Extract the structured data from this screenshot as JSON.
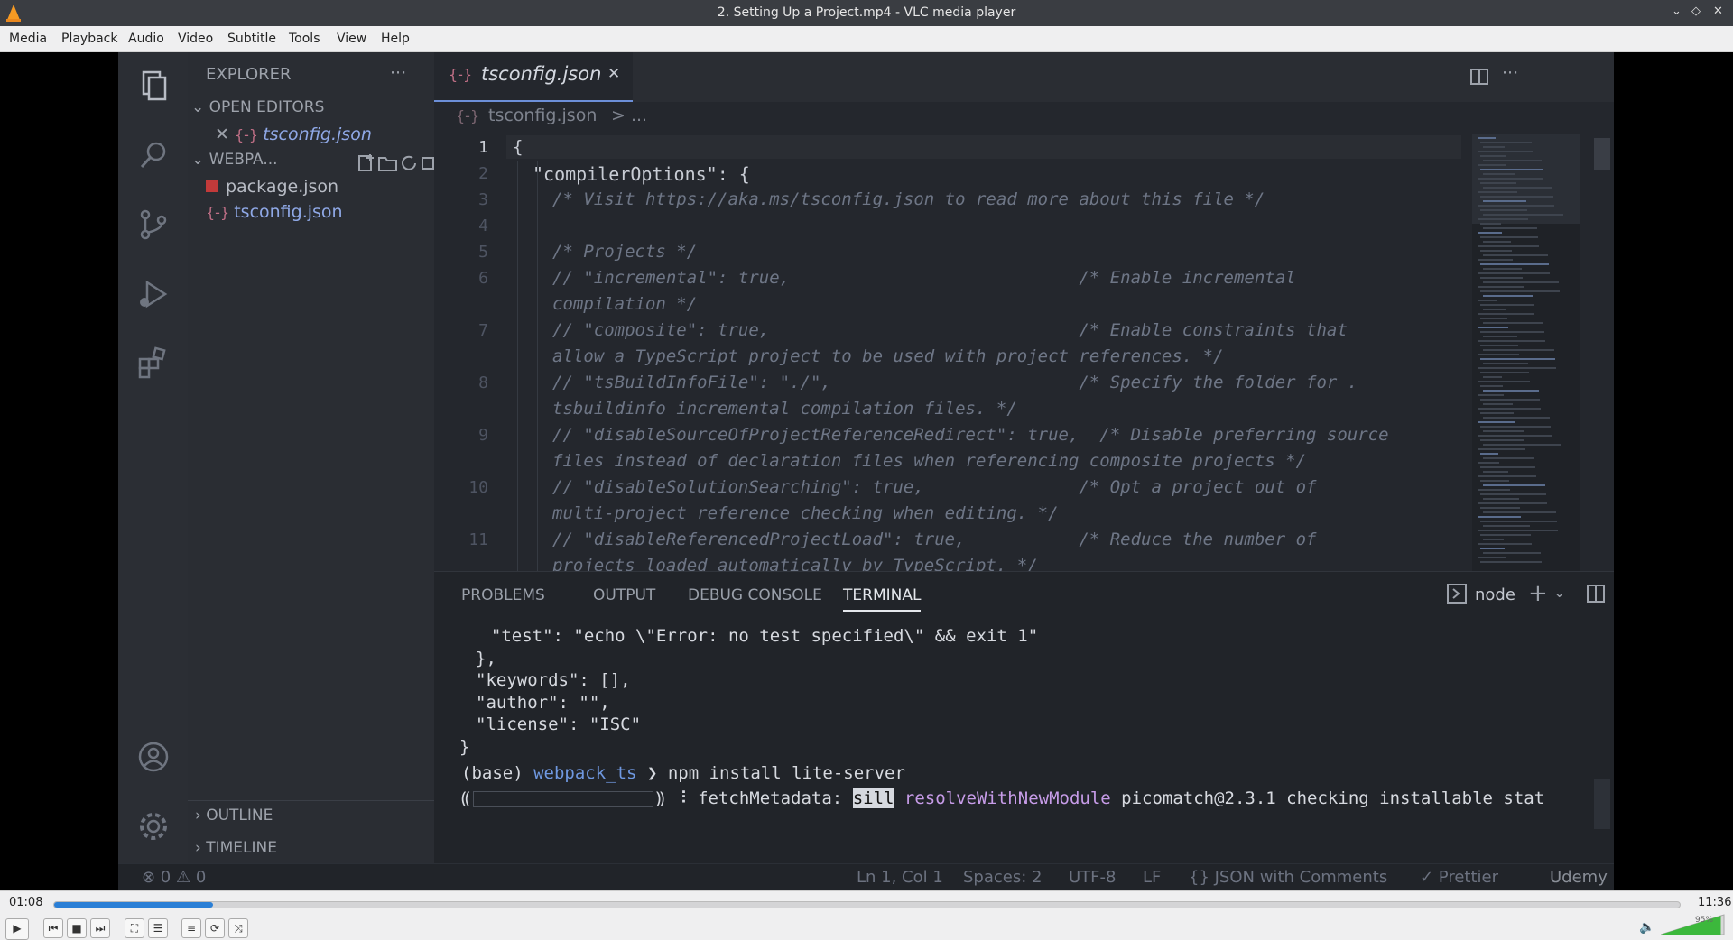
{
  "window": {
    "title": "2. Setting Up a Project.mp4 - VLC media player",
    "controls": [
      "⌄",
      "◇",
      "✕"
    ]
  },
  "menu": [
    "Media",
    "Playback",
    "Audio",
    "Video",
    "Subtitle",
    "Tools",
    "View",
    "Help"
  ],
  "vscode": {
    "sidebar": {
      "title": "EXPLORER",
      "more": "···",
      "open_editors_label": "OPEN EDITORS",
      "open_editor_file": "tsconfig.json",
      "folder_label": "WEBPA...",
      "files": [
        {
          "name": "package.json",
          "icon": "npm-file-icon"
        },
        {
          "name": "tsconfig.json",
          "icon": "json-file-icon"
        }
      ],
      "outline_label": "OUTLINE",
      "timeline_label": "TIMELINE"
    },
    "editor": {
      "tab_label": "tsconfig.json",
      "tab_close": "✕",
      "breadcrumb_file": "tsconfig.json",
      "breadcrumb_sep": "> ...",
      "lines": [
        {
          "n": "1",
          "text": "{"
        },
        {
          "n": "2",
          "text": "\"compilerOptions\": {"
        },
        {
          "n": "3",
          "text": "/* Visit https://aka.ms/tsconfig.json to read more about this file */"
        },
        {
          "n": "4",
          "text": ""
        },
        {
          "n": "5",
          "text": "/* Projects */"
        },
        {
          "n": "6",
          "text": "// \"incremental\": true,                            /* Enable incremental"
        },
        {
          "n": "",
          "text": "compilation */"
        },
        {
          "n": "7",
          "text": "// \"composite\": true,                              /* Enable constraints that"
        },
        {
          "n": "",
          "text": "allow a TypeScript project to be used with project references. */"
        },
        {
          "n": "8",
          "text": "// \"tsBuildInfoFile\": \"./\",                        /* Specify the folder for ."
        },
        {
          "n": "",
          "text": "tsbuildinfo incremental compilation files. */"
        },
        {
          "n": "9",
          "text": "// \"disableSourceOfProjectReferenceRedirect\": true,  /* Disable preferring source"
        },
        {
          "n": "",
          "text": "files instead of declaration files when referencing composite projects */"
        },
        {
          "n": "10",
          "text": "// \"disableSolutionSearching\": true,               /* Opt a project out of"
        },
        {
          "n": "",
          "text": "multi-project reference checking when editing. */"
        },
        {
          "n": "11",
          "text": "// \"disableReferencedProjectLoad\": true,           /* Reduce the number of"
        },
        {
          "n": "",
          "text": "projects loaded automatically by TypeScript. */"
        }
      ]
    },
    "panel": {
      "tabs": [
        "PROBLEMS",
        "OUTPUT",
        "DEBUG CONSOLE",
        "TERMINAL"
      ],
      "active_tab": "TERMINAL",
      "terminal_name": "node",
      "terminal_lines": [
        "  \"test\": \"echo \\\"Error: no test specified\\\" && exit 1\"",
        "},",
        "\"keywords\": [],",
        "\"author\": \"\",",
        "\"license\": \"ISC\"",
        "}"
      ],
      "prompt_env": "(base)",
      "prompt_dir": "webpack_ts",
      "prompt_arrow": "❯",
      "prompt_cmd": "npm install lite-server",
      "progress_prefix": "⸨",
      "progress_suffix": "⸩ ⠸ fetchMetadata:",
      "progress_sill": "sill",
      "progress_fn": "resolveWithNewModule",
      "progress_rest": "picomatch@2.3.1 checking installable stat"
    },
    "status": {
      "problems": "⊗ 0 ⚠ 0",
      "position": "Ln 1, Col 1",
      "spaces": "Spaces: 2",
      "encoding": "UTF-8",
      "eol": "LF",
      "language": "{} JSON with Comments",
      "prettier": "✓ Prettier",
      "watermark": "Udemy"
    }
  },
  "player": {
    "elapsed": "01:08",
    "total": "11:36",
    "progress": 0.098,
    "volume": "95%",
    "volume_level": 0.95,
    "accent": "#2a7fd6"
  }
}
